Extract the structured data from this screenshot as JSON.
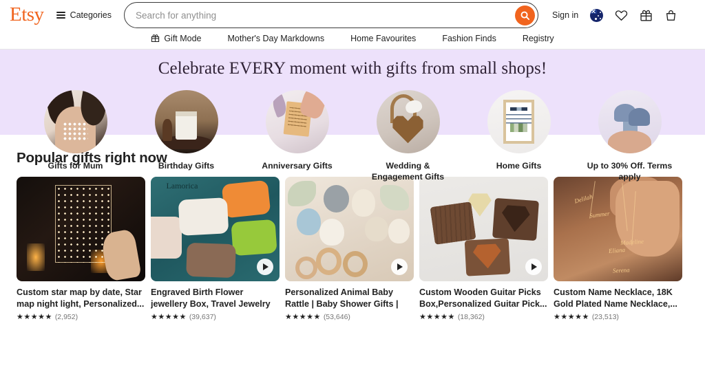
{
  "header": {
    "logo": "Etsy",
    "categories_label": "Categories",
    "categories_icon": "hamburger-icon",
    "search": {
      "placeholder": "Search for anything",
      "value": "",
      "button_icon": "search-icon",
      "button_color": "#F1641E"
    },
    "sign_in": "Sign in",
    "icons": [
      {
        "name": "region-flag-icon",
        "label": "Australia"
      },
      {
        "name": "heart-icon",
        "label": "Favourites"
      },
      {
        "name": "gift-icon",
        "label": "Gift Mode"
      },
      {
        "name": "cart-icon",
        "label": "Cart"
      }
    ]
  },
  "subnav": {
    "items": [
      {
        "label": "Gift Mode",
        "icon": "gift-icon"
      },
      {
        "label": "Mother's Day Markdowns",
        "icon": ""
      },
      {
        "label": "Home Favourites",
        "icon": ""
      },
      {
        "label": "Fashion Finds",
        "icon": ""
      },
      {
        "label": "Registry",
        "icon": ""
      }
    ]
  },
  "banner": {
    "headline": "Celebrate EVERY moment with gifts from small shops!",
    "background_color": "#EDE1FB",
    "categories": [
      {
        "label": "Gifts for Mum",
        "art": "c1"
      },
      {
        "label": "Birthday Gifts",
        "art": "c2"
      },
      {
        "label": "Anniversary Gifts",
        "art": "c3"
      },
      {
        "label": "Wedding & Engagement Gifts",
        "art": "c4"
      },
      {
        "label": "Home Gifts",
        "art": "c5"
      },
      {
        "label": "Up to 30% Off. Terms apply",
        "art": "c6"
      }
    ]
  },
  "popular": {
    "title": "Popular gifts right now",
    "stars": "★★★★★",
    "products": [
      {
        "title": "Custom star map by date, Star map night light, Personalized...",
        "reviews": "(2,952)",
        "has_video": false,
        "art": "p1"
      },
      {
        "title": "Engraved Birth Flower jewellery Box, Travel Jewelry Box,...",
        "reviews": "(39,637)",
        "has_video": true,
        "art": "p2",
        "brand_text": "Lamorica"
      },
      {
        "title": "Personalized Animal Baby Rattle | Baby Shower Gifts | Custom...",
        "reviews": "(53,646)",
        "has_video": true,
        "art": "p3"
      },
      {
        "title": "Custom Wooden Guitar Picks Box,Personalized Guitar Pick...",
        "reviews": "(18,362)",
        "has_video": true,
        "art": "p4"
      },
      {
        "title": "Custom Name Necklace, 18K Gold Plated Name Necklace,...",
        "reviews": "(23,513)",
        "has_video": false,
        "art": "p5",
        "names": [
          "Delilah",
          "Summer",
          "Madeline",
          "Eliana",
          "Serena"
        ]
      }
    ]
  }
}
